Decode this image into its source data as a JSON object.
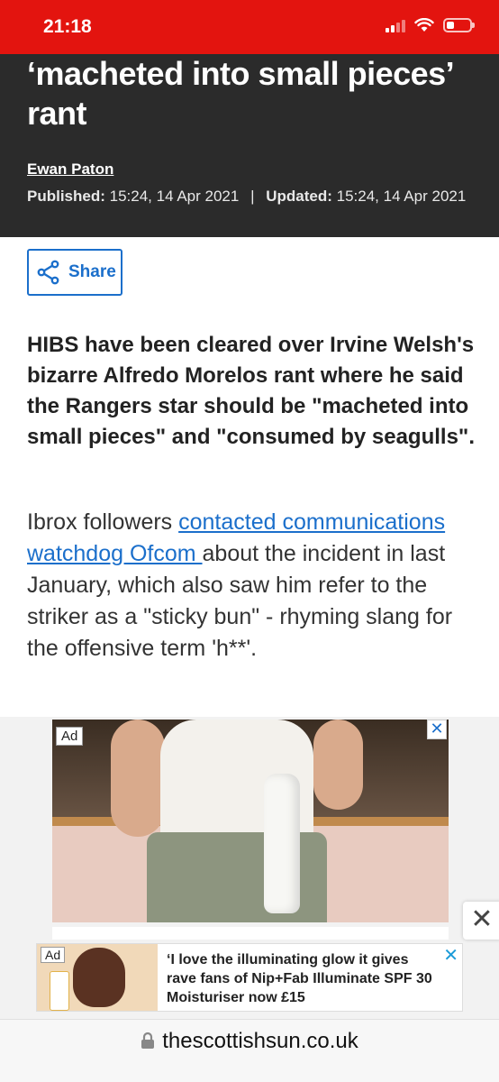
{
  "status_bar": {
    "time": "21:18",
    "icons": [
      "signal-icon",
      "wifi-icon",
      "battery-low-icon"
    ],
    "color": "#e3140f"
  },
  "header": {
    "headline_line1": "‘macheted into small pieces’",
    "headline_line2": "rant",
    "author": "Ewan Paton",
    "published_label": "Published:",
    "published_value": "15:24, 14 Apr 2021",
    "separator": "|",
    "updated_label": "Updated:",
    "updated_value": "15:24, 14 Apr 2021",
    "background": "#2b2b2b"
  },
  "share": {
    "label": "Share",
    "icon": "share-icon",
    "color": "#1b6fcb"
  },
  "article": {
    "lead": "HIBS have been cleared over Irvine Welsh's bizarre Alfredo Morelos rant where he said the Rangers star should be \"macheted into small pieces\" and \"consumed by seagulls\".",
    "para_before_link": "Ibrox followers ",
    "link_text": "contacted communications watchdog Ofcom ",
    "para_after_link": "about the incident in last January, which also saw him refer to the striker as a \"sticky bun\" - rhyming slang for the offensive term 'h**'."
  },
  "ad": {
    "badge": "Ad",
    "close_symbol": "✕",
    "dismiss_symbol": "✕"
  },
  "sticky_ad": {
    "badge": "Ad",
    "text": "‘I love the illuminating glow it gives rave fans of Nip+Fab Illuminate SPF 30 Moisturiser now £15",
    "close_symbol": "✕"
  },
  "url_bar": {
    "url": "thescottishsun.co.uk",
    "icon": "lock-icon"
  }
}
